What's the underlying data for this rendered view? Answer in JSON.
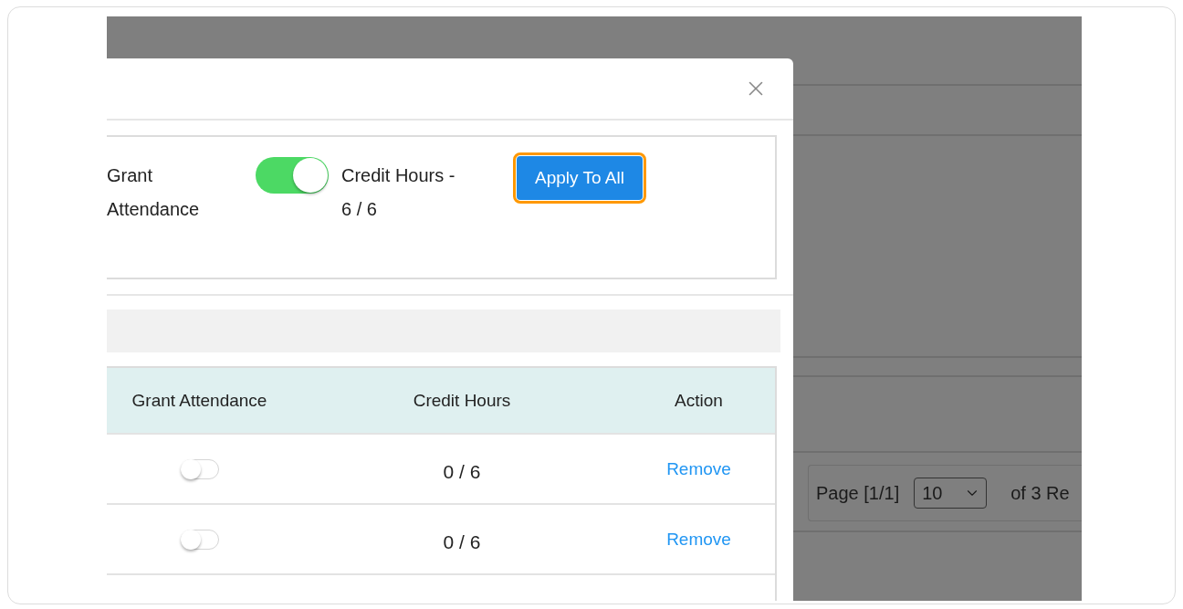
{
  "dialog": {
    "bulk_settings": {
      "label": "Grant Attendance",
      "grant_attendance": {
        "on": true
      },
      "credit_hours": "Credit Hours - 6 / 6",
      "button": "Apply To All"
    },
    "table": {
      "columns": [
        "Grant Attendance",
        "Credit Hours",
        "Action"
      ],
      "rows": [
        {
          "grant_attendance": {
            "on": false
          },
          "credit_hours": "0 / 6",
          "action": "Remove"
        },
        {
          "grant_attendance": {
            "on": false
          },
          "credit_hours": "0 / 6",
          "action": "Remove"
        }
      ]
    }
  },
  "background": {
    "pager": {
      "page": "Page [1/1]",
      "page_size": "10",
      "records": "of 3 Re"
    }
  }
}
